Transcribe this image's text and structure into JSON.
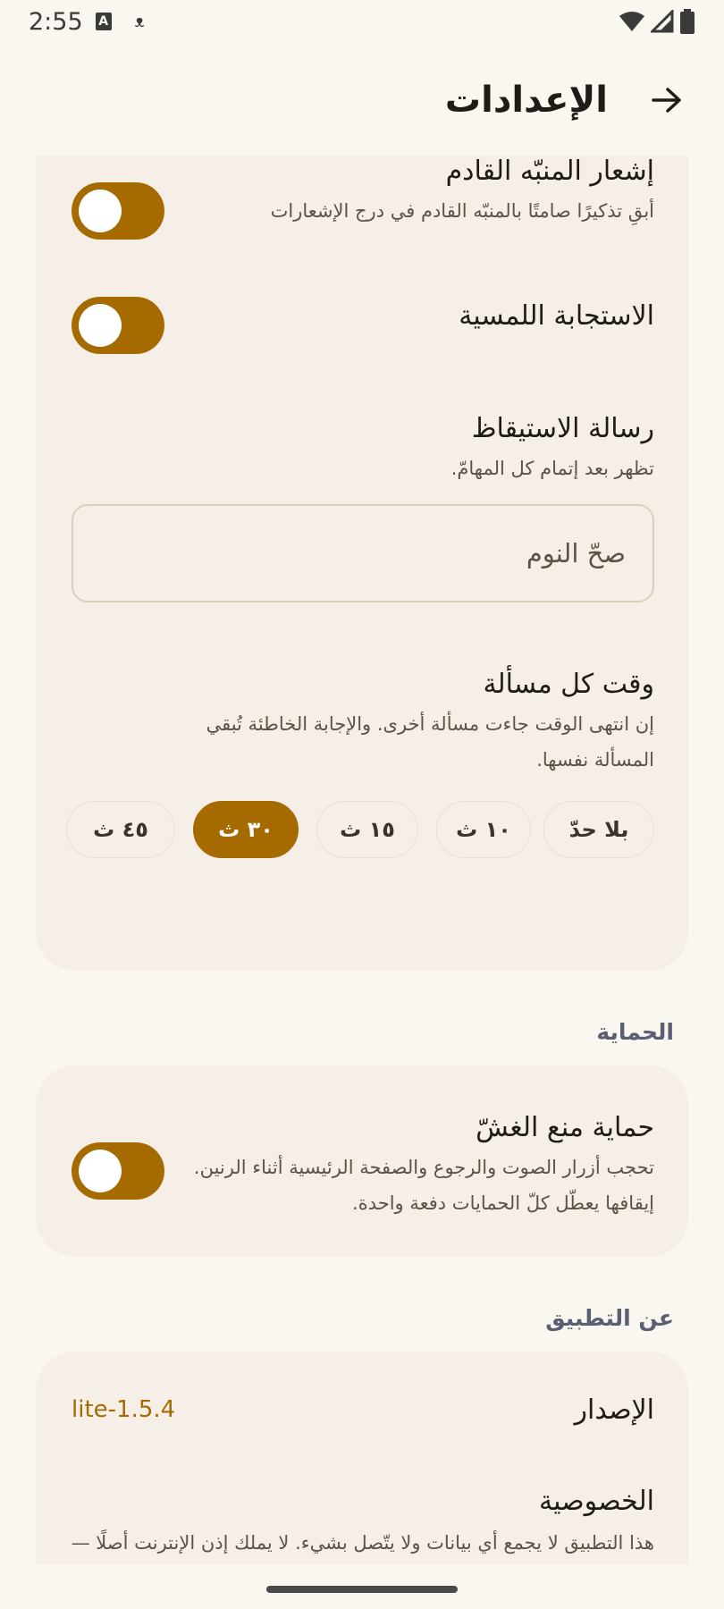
{
  "status_bar": {
    "time": "2:55",
    "icons": [
      "a-box-icon",
      "cat-icon",
      "wifi-icon",
      "signal-icon",
      "battery-icon"
    ]
  },
  "app_bar": {
    "title": "الإعدادات",
    "back_icon": "arrow-icon"
  },
  "playback_card": {
    "next_alarm": {
      "title": "إشعار المنبّه القادم",
      "subtitle": "أبقِ تذكيرًا صامتًا بالمنبّه القادم في درج الإشعارات",
      "enabled": true
    },
    "haptics": {
      "title": "الاستجابة اللمسية",
      "enabled": true
    },
    "wake_message": {
      "title": "رسالة الاستيقاظ",
      "subtitle": "تظهر بعد إتمام كل المهامّ.",
      "placeholder": "صحّ النوم"
    },
    "question_time": {
      "title": "وقت كل مسألة",
      "subtitle_line1": "إن انتهى الوقت جاءت مسألة أخرى. والإجابة الخاطئة تُبقي",
      "subtitle_line2": "المسألة نفسها.",
      "options": [
        "بلا حدّ",
        "١٠ ث",
        "١٥ ث",
        "٣٠ ث",
        "٤٥ ث"
      ],
      "selected": "٣٠ ث"
    }
  },
  "protection_section": {
    "label": "الحماية",
    "anti_cheat": {
      "title": "حماية منع الغشّ",
      "subtitle_line1": "تحجب أزرار الصوت والرجوع والصفحة الرئيسية أثناء الرنين.",
      "subtitle_line2": "إيقافها يعطّل كلّ الحمايات دفعة واحدة.",
      "enabled": true
    }
  },
  "about_section": {
    "label": "عن التطبيق",
    "version": {
      "title": "الإصدار",
      "value": "lite-1.5.4"
    },
    "privacy": {
      "title": "الخصوصية",
      "subtitle": "هذا التطبيق لا يجمع أي بيانات ولا يتّصل بشيء. لا يملك إذن الإنترنت أصلًا —"
    }
  },
  "colors": {
    "accent": "#a56b00",
    "background": "#faf6f0",
    "card": "#f5efe7",
    "section_label": "#5a5f73"
  }
}
